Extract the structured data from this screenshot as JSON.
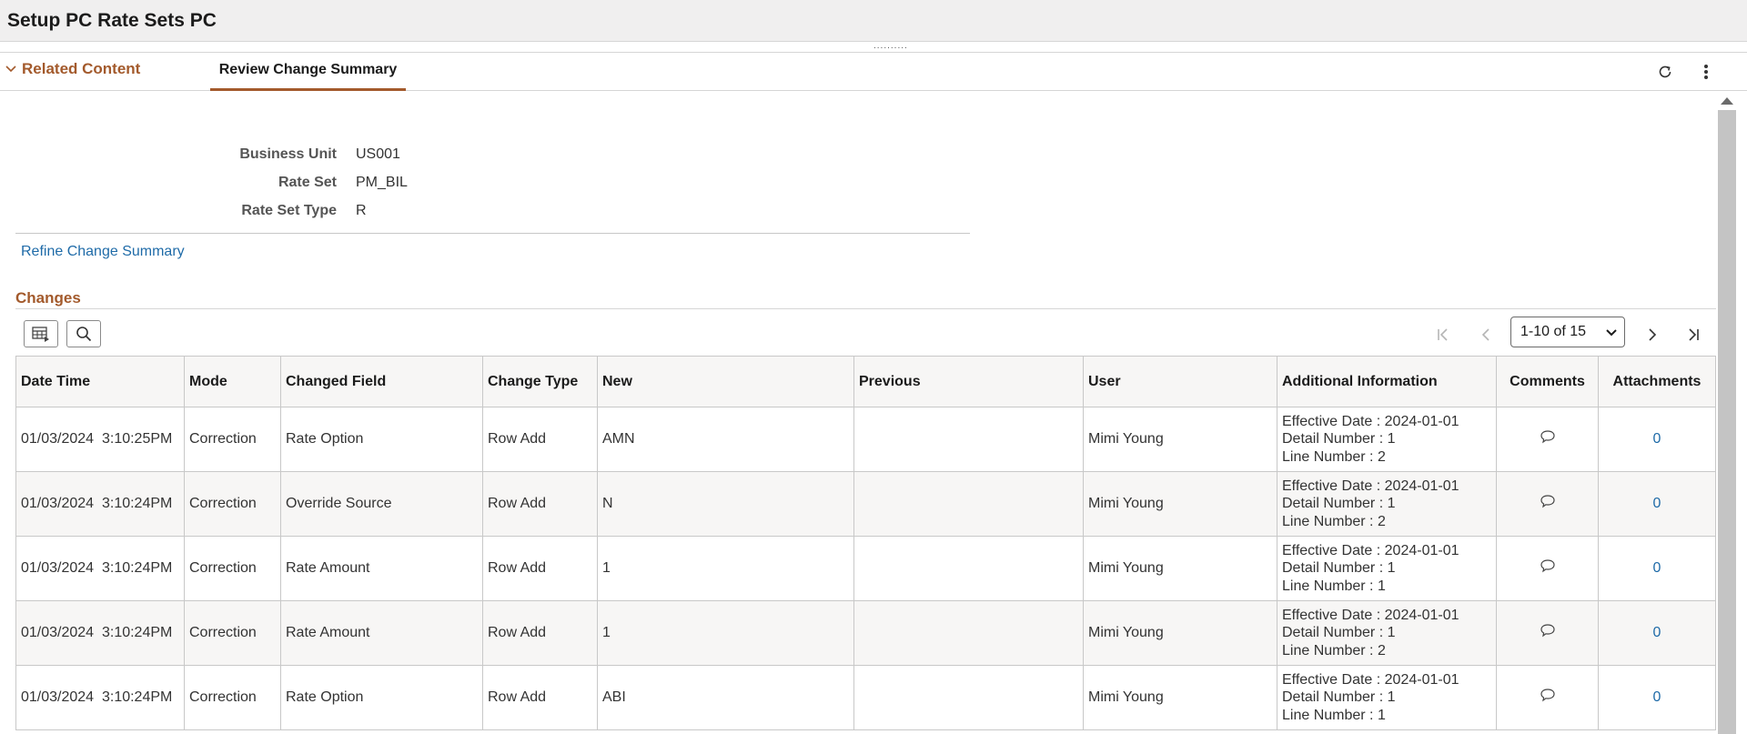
{
  "page": {
    "title": "Setup PC Rate Sets PC"
  },
  "tabs": {
    "related_label": "Related Content",
    "active_label": "Review Change Summary"
  },
  "fields": [
    {
      "label": "Business Unit",
      "value": "US001"
    },
    {
      "label": "Rate Set",
      "value": "PM_BIL"
    },
    {
      "label": "Rate Set Type",
      "value": "R"
    }
  ],
  "refine_link": "Refine Change Summary",
  "changes": {
    "heading": "Changes",
    "pagination": {
      "range": "1-10 of 15"
    },
    "columns": [
      "Date Time",
      "Mode",
      "Changed Field",
      "Change Type",
      "New",
      "Previous",
      "User",
      "Additional Information",
      "Comments",
      "Attachments"
    ],
    "rows": [
      {
        "datetime": "01/03/2024  3:10:25PM",
        "mode": "Correction",
        "field": "Rate Option",
        "type": "Row Add",
        "new": "AMN",
        "previous": "",
        "user": "Mimi Young",
        "info": [
          "Effective Date : 2024-01-01",
          "Detail Number : 1",
          "Line Number : 2"
        ],
        "attachments": "0"
      },
      {
        "datetime": "01/03/2024  3:10:24PM",
        "mode": "Correction",
        "field": "Override Source",
        "type": "Row Add",
        "new": "N",
        "previous": "",
        "user": "Mimi Young",
        "info": [
          "Effective Date : 2024-01-01",
          "Detail Number : 1",
          "Line Number : 2"
        ],
        "attachments": "0"
      },
      {
        "datetime": "01/03/2024  3:10:24PM",
        "mode": "Correction",
        "field": "Rate Amount",
        "type": "Row Add",
        "new": "1",
        "previous": "",
        "user": "Mimi Young",
        "info": [
          "Effective Date : 2024-01-01",
          "Detail Number : 1",
          "Line Number : 1"
        ],
        "attachments": "0"
      },
      {
        "datetime": "01/03/2024  3:10:24PM",
        "mode": "Correction",
        "field": "Rate Amount",
        "type": "Row Add",
        "new": "1",
        "previous": "",
        "user": "Mimi Young",
        "info": [
          "Effective Date : 2024-01-01",
          "Detail Number : 1",
          "Line Number : 2"
        ],
        "attachments": "0"
      },
      {
        "datetime": "01/03/2024  3:10:24PM",
        "mode": "Correction",
        "field": "Rate Option",
        "type": "Row Add",
        "new": "ABI",
        "previous": "",
        "user": "Mimi Young",
        "info": [
          "Effective Date : 2024-01-01",
          "Detail Number : 1",
          "Line Number : 1"
        ],
        "attachments": "0"
      }
    ]
  },
  "icons": {
    "collapse": "chevron-down-icon",
    "refresh": "refresh-icon",
    "actions": "more-vertical-icon",
    "grid_personalize": "grid-settings-icon",
    "grid_find": "search-icon",
    "first": "first-page-icon",
    "prev": "previous-page-icon",
    "next": "next-page-icon",
    "last": "last-page-icon",
    "comment": "comment-icon"
  },
  "colors": {
    "accent": "#a35a2c",
    "link": "#1f6ba8"
  }
}
